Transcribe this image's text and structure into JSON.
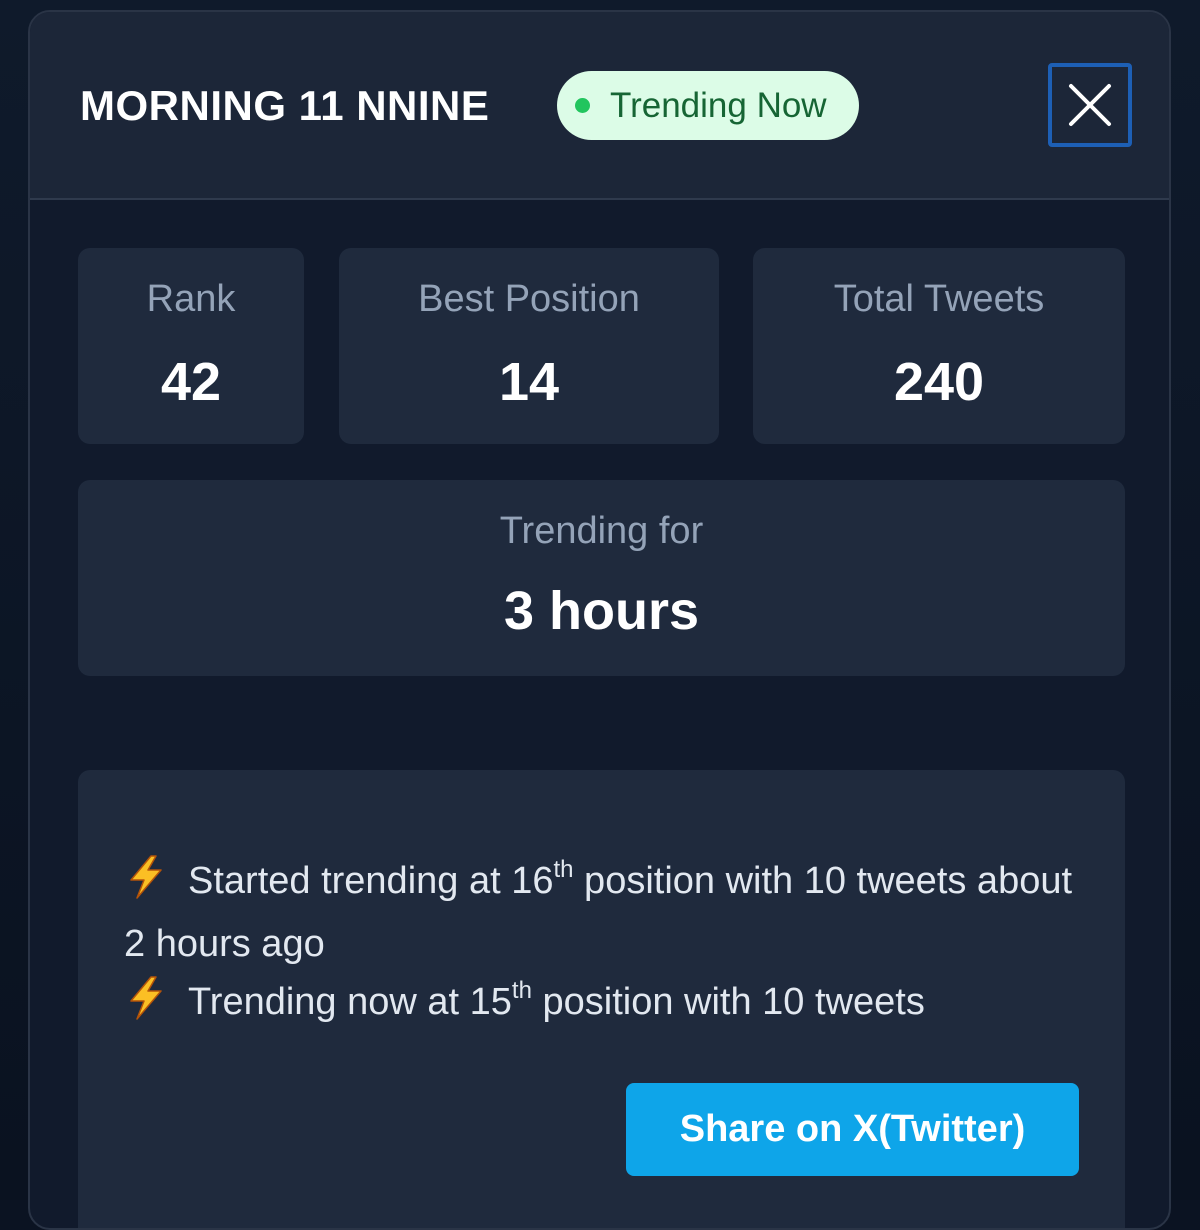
{
  "modal": {
    "title": "MORNING 11 NNINE",
    "badge": "Trending Now",
    "close_icon": "close-icon"
  },
  "stats": {
    "rank_label": "Rank",
    "rank_value": "42",
    "best_label": "Best Position",
    "best_value": "14",
    "tweets_label": "Total Tweets",
    "tweets_value": "240",
    "duration_label": "Trending for",
    "duration_value": "3 hours"
  },
  "timeline": {
    "icon": "lightning-bolt-icon",
    "entries": [
      {
        "prefix": "Started trending at 16",
        "ordinal_suffix": "th",
        "suffix": " position with 10 tweets about 2 hours ago"
      },
      {
        "prefix": "Trending now at 15",
        "ordinal_suffix": "th",
        "suffix": " position with 10 tweets"
      }
    ]
  },
  "share_button": "Share on X(Twitter)",
  "colors": {
    "background": "#111a2c",
    "card": "#1f2a3d",
    "badge_bg": "#dcfce7",
    "badge_text": "#166534",
    "badge_dot": "#22c55e",
    "share_button": "#0ea5e9",
    "close_border": "#1d5fb5"
  }
}
